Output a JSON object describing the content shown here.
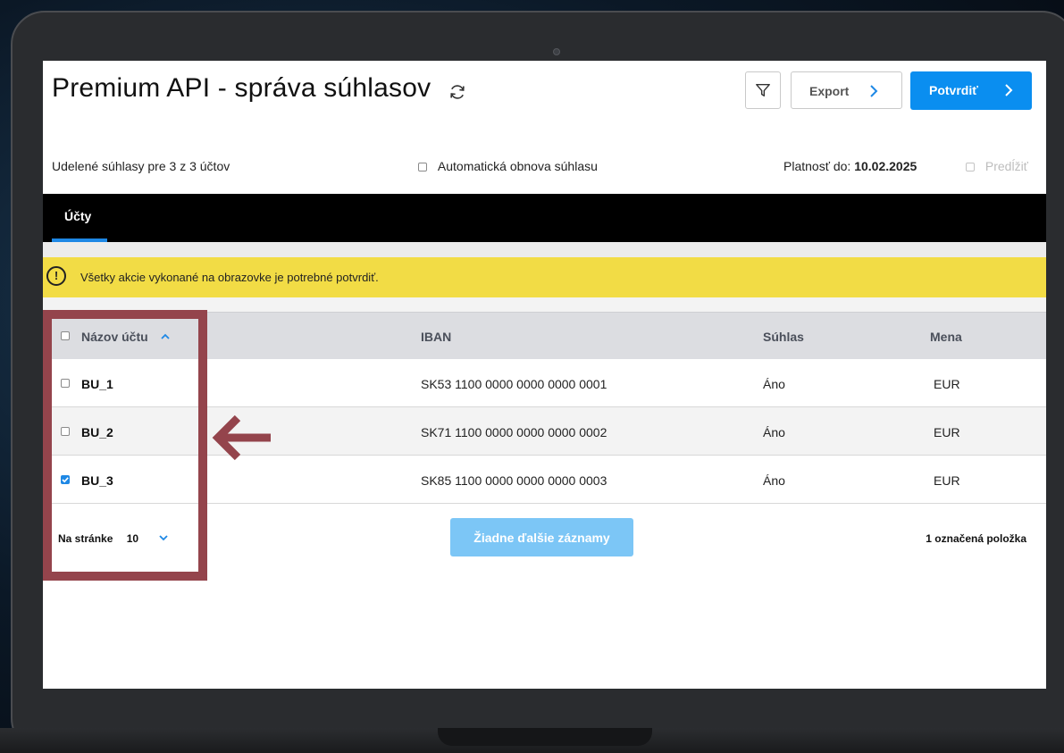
{
  "header": {
    "title": "Premium API - správa súhlasov",
    "export_label": "Export",
    "confirm_label": "Potvrdiť"
  },
  "info": {
    "granted": "Udelené súhlasy pre 3 z 3 účtov",
    "auto_renew_label": "Automatická obnova súhlasu",
    "valid_label": "Platnosť do:",
    "valid_date": "10.02.2025",
    "extend_label": "Predĺžiť"
  },
  "tabs": [
    {
      "label": "Účty",
      "active": true
    }
  ],
  "banner": {
    "icon": "!",
    "text": "Všetky akcie vykonané na obrazovke je potrebné potvrdiť."
  },
  "table": {
    "columns": [
      "Názov účtu",
      "IBAN",
      "Súhlas",
      "Mena"
    ],
    "rows": [
      {
        "name": "BU_1",
        "iban": "SK53 1100 0000 0000 0000 0001",
        "consent": "Áno",
        "currency": "EUR",
        "checked": false
      },
      {
        "name": "BU_2",
        "iban": "SK71 1100 0000 0000 0000 0002",
        "consent": "Áno",
        "currency": "EUR",
        "checked": false
      },
      {
        "name": "BU_3",
        "iban": "SK85 1100 0000 0000 0000 0003",
        "consent": "Áno",
        "currency": "EUR",
        "checked": true
      }
    ]
  },
  "footer": {
    "per_page_label": "Na stránke",
    "per_page_value": "10",
    "no_more_label": "Žiadne ďalšie záznamy",
    "selected_count": "1 označená položka"
  },
  "colors": {
    "accent": "#0a8ef0",
    "banner": "#f2dc45",
    "annotation": "#94444c"
  }
}
